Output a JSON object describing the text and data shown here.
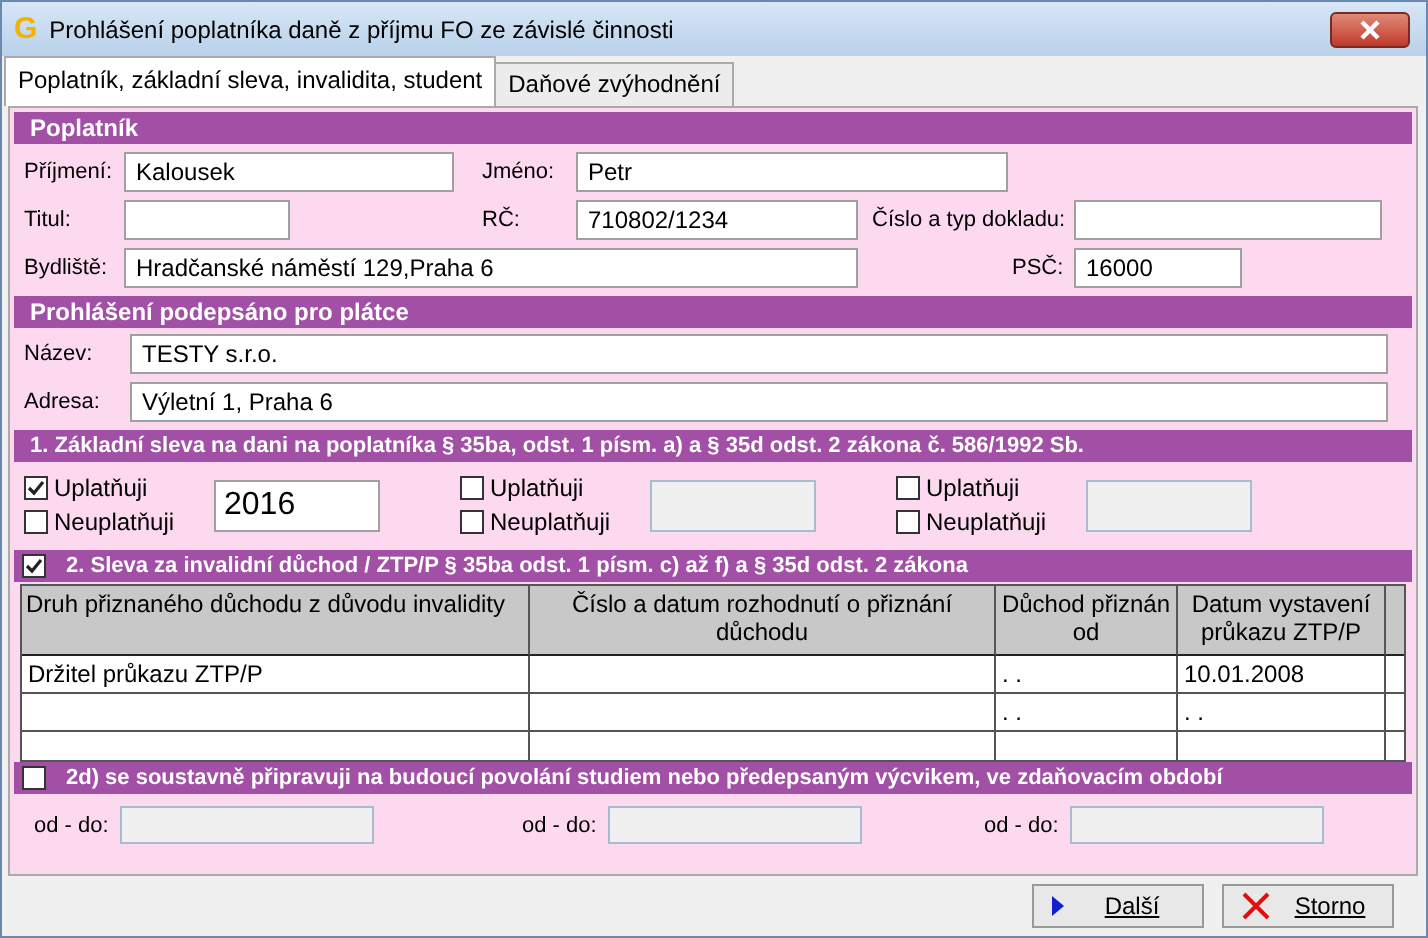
{
  "window": {
    "logo": "G",
    "title": "Prohlášení poplatníka daně z příjmu FO ze závislé činnosti"
  },
  "tabs": [
    {
      "label": "Poplatník, základní sleva, invalidita, student",
      "selected": true
    },
    {
      "label": "Daňové zvýhodnění",
      "selected": false
    }
  ],
  "poplatnik": {
    "title": "Poplatník",
    "fields": [
      {
        "label": "Příjmení:",
        "value": "Kalousek"
      },
      {
        "label": "Jméno:",
        "value": "Petr"
      },
      {
        "label": "Titul:"
      },
      {
        "label": "RČ:",
        "value": "710802/1234"
      },
      {
        "label": "Číslo a typ dokladu:"
      },
      {
        "label": "Bydliště:",
        "value": "Hradčanské náměstí 129,Praha 6"
      },
      {
        "label": "PSČ:",
        "value": "16000"
      }
    ]
  },
  "platce": {
    "title": "Prohlášení podepsáno pro plátce",
    "fields": [
      {
        "label": "Název:",
        "value": "TESTY s.r.o."
      },
      {
        "label": "Adresa:",
        "value": "Výletní 1, Praha 6"
      }
    ]
  },
  "zakladni_sleva": {
    "title": "1. Základní sleva na dani na poplatníka § 35ba, odst. 1 písm. a) a § 35d odst. 2 zákona č. 586/1992 Sb.",
    "groups": [
      {
        "uplatnuji": {
          "label": "Uplatňuji",
          "checked": true
        },
        "neuplatnuji": {
          "label": "Neuplatňuji",
          "checked": false
        },
        "year": {
          "value": "2016",
          "disabled": false
        }
      },
      {
        "uplatnuji": {
          "label": "Uplatňuji",
          "checked": false
        },
        "neuplatnuji": {
          "label": "Neuplatňuji",
          "checked": false
        },
        "year": {
          "disabled": true
        }
      },
      {
        "uplatnuji": {
          "label": "Uplatňuji",
          "checked": false
        },
        "neuplatnuji": {
          "label": "Neuplatňuji",
          "checked": false
        },
        "year": {
          "disabled": true
        }
      }
    ]
  },
  "invalidita": {
    "title": "2. Sleva za invalidní důchod / ZTP/P § 35ba odst. 1 písm. c) až f) a § 35d odst. 2 zákona",
    "checked": true,
    "table": {
      "columns": [
        "Druh přiznaného důchodu z důvodu invalidity",
        "Číslo a datum rozhodnutí o přiznání důchodu",
        "Důchod přiznán od",
        "Datum vystavení průkazu ZTP/P"
      ],
      "rows": [
        {
          "cells": [
            "Držitel průkazu ZTP/P",
            null,
            ". .",
            "10.01.2008"
          ]
        },
        {
          "cells": [
            null,
            null,
            ". .",
            ". ."
          ]
        },
        {
          "cells": [
            null,
            null,
            null,
            null
          ]
        }
      ]
    }
  },
  "student": {
    "title": "2d) se soustavně připravuji na budoucí povolání studiem nebo předepsaným výcvikem, ve zdaňovacím období",
    "checked": false,
    "periods": [
      {
        "label": "od - do:",
        "disabled": true
      },
      {
        "label": "od - do:",
        "disabled": true
      },
      {
        "label": "od - do:",
        "disabled": true
      }
    ]
  },
  "buttons": [
    {
      "kind": "next",
      "label": "Další"
    },
    {
      "kind": "cancel",
      "label": "Storno"
    }
  ]
}
